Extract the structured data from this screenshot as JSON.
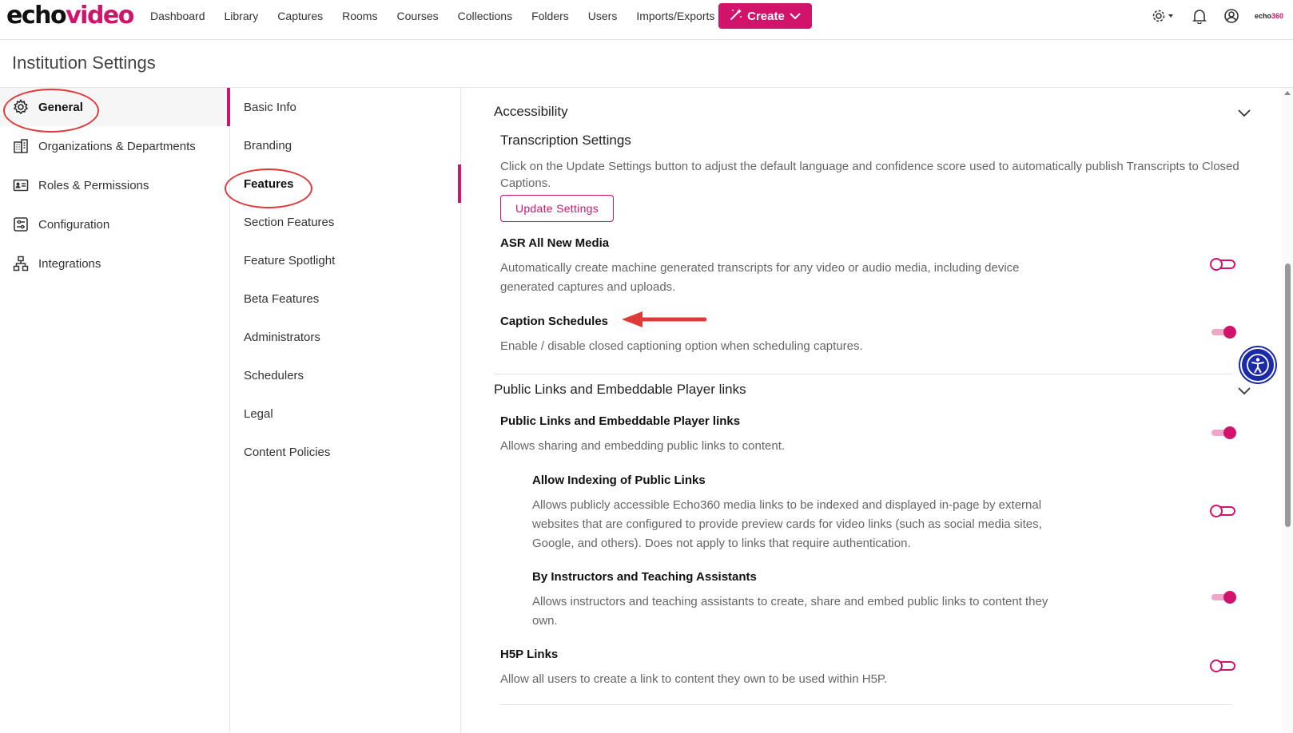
{
  "brand": {
    "logo_part1": "echo",
    "logo_part2": "video",
    "mini_part1": "echo",
    "mini_part2": "360"
  },
  "nav": [
    "Dashboard",
    "Library",
    "Captures",
    "Rooms",
    "Courses",
    "Collections",
    "Folders",
    "Users",
    "Imports/Exports"
  ],
  "create_label": "Create",
  "page_title": "Institution Settings",
  "left_menu": [
    {
      "label": "General",
      "icon": "gear-icon"
    },
    {
      "label": "Organizations & Departments",
      "icon": "building-icon"
    },
    {
      "label": "Roles & Permissions",
      "icon": "id-card-icon"
    },
    {
      "label": "Configuration",
      "icon": "config-icon"
    },
    {
      "label": "Integrations",
      "icon": "network-icon"
    }
  ],
  "sub_menu": [
    "Basic Info",
    "Branding",
    "Features",
    "Section Features",
    "Feature Spotlight",
    "Beta Features",
    "Administrators",
    "Schedulers",
    "Legal",
    "Content Policies"
  ],
  "accessibility": {
    "title": "Accessibility",
    "transcription_title": "Transcription Settings",
    "transcription_desc": "Click on the Update Settings button to adjust the default language and confidence score used to automatically publish Transcripts to Closed Captions.",
    "update_button": "Update Settings",
    "asr_title": "ASR All New Media",
    "asr_desc": "Automatically create machine generated transcripts for any video or audio media, including device generated captures and uploads.",
    "asr_on": false,
    "caption_title": "Caption Schedules",
    "caption_desc": "Enable / disable closed captioning option when scheduling captures.",
    "caption_on": true
  },
  "public_links": {
    "title": "Public Links and Embeddable Player links",
    "main_title": "Public Links and Embeddable Player links",
    "main_desc": "Allows sharing and embedding public links to content.",
    "main_on": true,
    "indexing_title": "Allow Indexing of Public Links",
    "indexing_desc": "Allows publicly accessible Echo360 media links to be indexed and displayed in-page by external websites that are configured to provide preview cards for video links (such as social media sites, Google, and others). Does not apply to links that require authentication.",
    "indexing_on": false,
    "instructors_title": "By Instructors and Teaching Assistants",
    "instructors_desc": "Allows instructors and teaching assistants to create, share and embed public links to content they own.",
    "instructors_on": true,
    "h5p_title": "H5P Links",
    "h5p_desc": "Allow all users to create a link to content they own to be used within H5P.",
    "h5p_on": false
  },
  "colors": {
    "accent": "#d1136b",
    "annotation": "#e03a3a",
    "a11y": "#1a2aa8"
  }
}
